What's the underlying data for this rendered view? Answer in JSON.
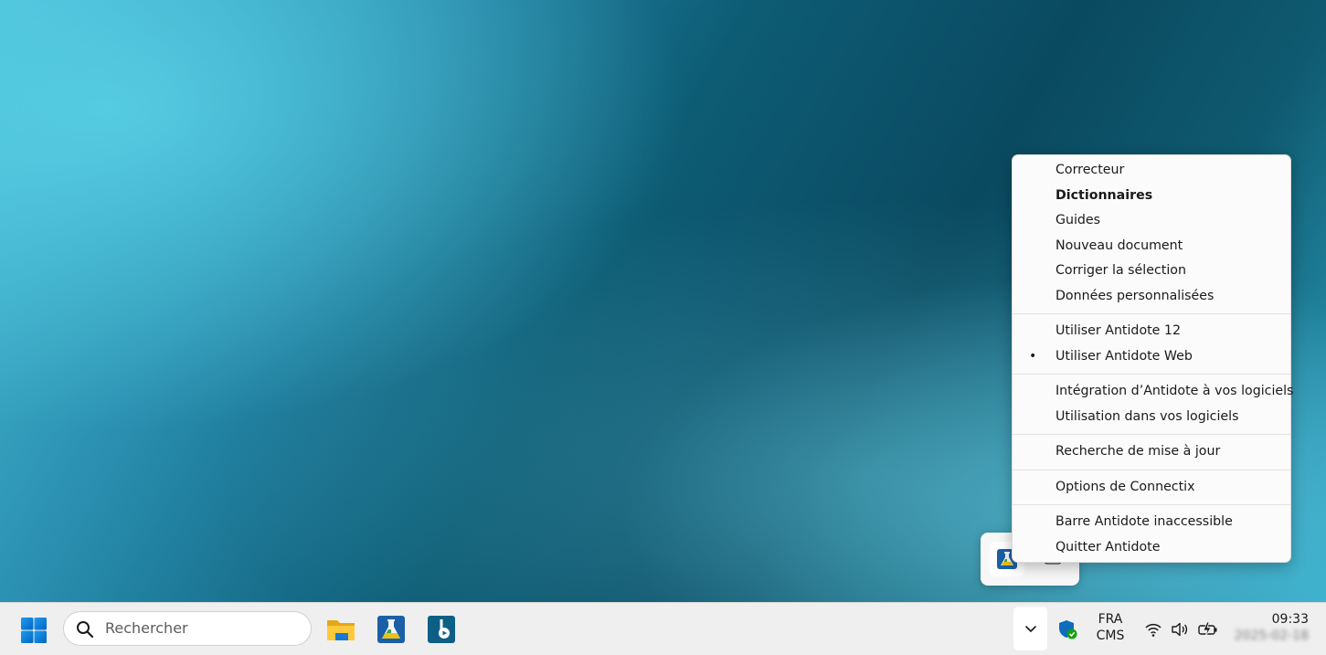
{
  "context_menu": {
    "groups": [
      {
        "items": [
          {
            "label": "Correcteur",
            "bold": false
          },
          {
            "label": "Dictionnaires",
            "bold": true
          },
          {
            "label": "Guides",
            "bold": false
          },
          {
            "label": "Nouveau document",
            "bold": false
          },
          {
            "label": "Corriger la sélection",
            "bold": false
          },
          {
            "label": "Données personnalisées",
            "bold": false
          }
        ]
      },
      {
        "items": [
          {
            "label": "Utiliser Antidote 12",
            "checked": false
          },
          {
            "label": "Utiliser Antidote Web",
            "checked": true
          }
        ]
      },
      {
        "items": [
          {
            "label": "Intégration d’Antidote à vos logiciels"
          },
          {
            "label": "Utilisation dans vos logiciels"
          }
        ]
      },
      {
        "items": [
          {
            "label": "Recherche de mise à jour"
          }
        ]
      },
      {
        "items": [
          {
            "label": "Options de Connectix"
          }
        ]
      },
      {
        "items": [
          {
            "label": "Barre Antidote inaccessible"
          },
          {
            "label": "Quitter Antidote"
          }
        ]
      }
    ],
    "bullet_glyph": "•"
  },
  "taskbar": {
    "search_placeholder": "Rechercher",
    "pinned_apps": [
      "file-explorer-icon",
      "antidote-icon",
      "media-player-icon"
    ],
    "tray": {
      "chevron_icon": "chevron-up-icon",
      "language_line1": "FRA",
      "language_line2": "CMS",
      "time": "09:33",
      "date": "2025-02-18"
    }
  },
  "colors": {
    "accent_blue": "#0078d4",
    "taskbar_bg": "#efefef",
    "menu_bg": "#fbfbfb"
  }
}
